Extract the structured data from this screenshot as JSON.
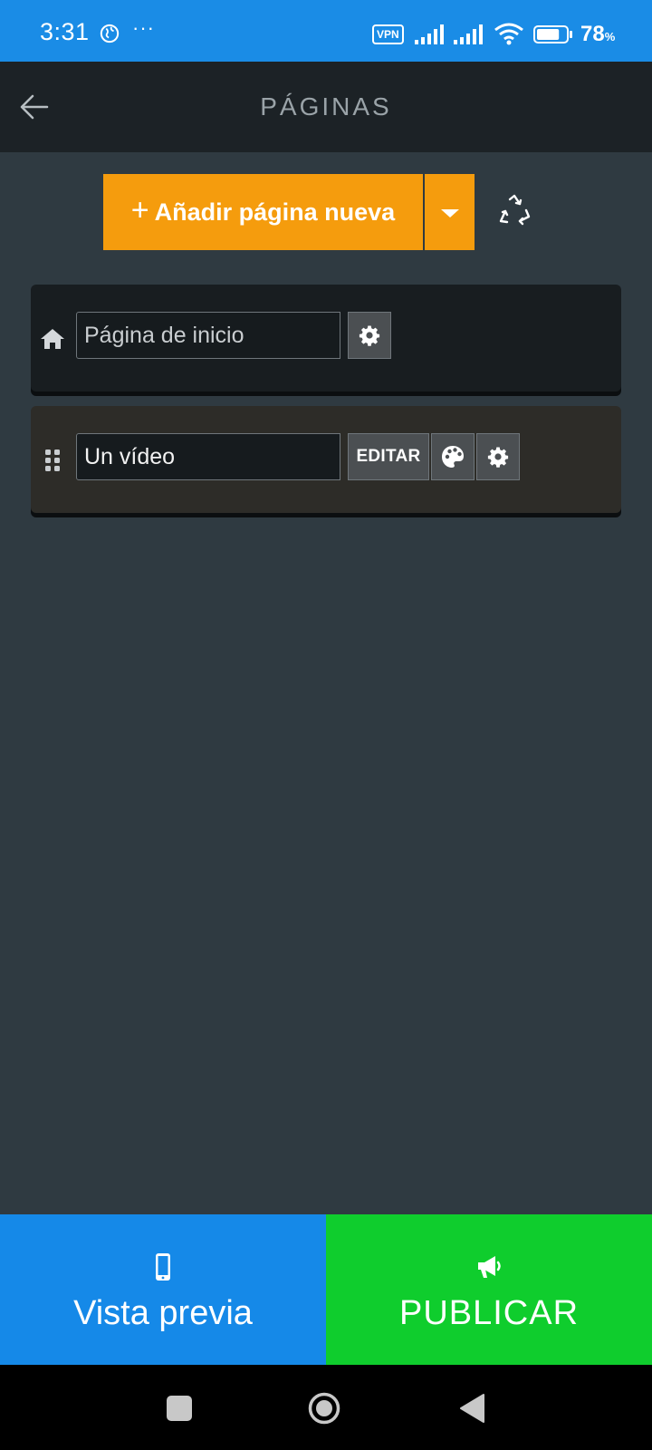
{
  "status_bar": {
    "time": "3:31",
    "more": "···",
    "vpn": "VPN",
    "battery_percent": "78",
    "battery_unit": "%",
    "battery_level": 0.78,
    "icons": [
      "globe-icon",
      "signal-icon",
      "signal-icon",
      "wifi-icon",
      "battery-icon"
    ]
  },
  "app_bar": {
    "title": "PÁGINAS",
    "back_icon": "arrow-left-icon"
  },
  "toolbar": {
    "add_label": "Añadir página nueva",
    "add_icon": "plus-icon",
    "dropdown_icon": "caret-down-icon",
    "recycle_icon": "recycle-icon"
  },
  "pages": [
    {
      "icon": "home-icon",
      "name": "Página de inicio",
      "actions": [
        "gear-icon"
      ]
    },
    {
      "icon": "drag-handle-icon",
      "name": "Un vídeo",
      "edit_label": "EDITAR",
      "actions": [
        "palette-icon",
        "gear-icon"
      ]
    }
  ],
  "bottom_actions": {
    "preview_label": "Vista previa",
    "preview_icon": "phone-icon",
    "publish_label": "PUBLICAR",
    "publish_icon": "megaphone-icon"
  },
  "colors": {
    "status_bar": "#1a8ce6",
    "app_bar": "#1c2226",
    "background": "#2f3a41",
    "accent": "#f59c0d",
    "preview": "#1589e8",
    "publish": "#0fcd2d"
  }
}
